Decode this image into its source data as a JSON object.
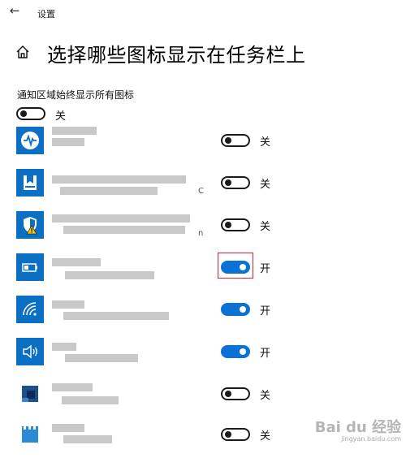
{
  "window": {
    "title": "设置",
    "back_icon": "back-arrow-icon"
  },
  "header": {
    "icon": "home-icon",
    "title": "选择哪些图标显示在任务栏上"
  },
  "master": {
    "label": "通知区域始终显示所有图标",
    "on": false,
    "state_text": "关"
  },
  "apps": [
    {
      "icon": "pulse-app-icon",
      "icon_color": "#0b6fc4",
      "on": false,
      "state_text": "关",
      "trail": ""
    },
    {
      "icon": "bookmark-app-icon",
      "icon_color": "#0b6fc4",
      "on": false,
      "state_text": "关",
      "trail": "C"
    },
    {
      "icon": "security-shield-warning-icon",
      "icon_color": "#0b6fc4",
      "on": false,
      "state_text": "关",
      "trail": "n"
    },
    {
      "icon": "battery-icon",
      "icon_color": "#0b6fc4",
      "on": true,
      "state_text": "开",
      "trail": ""
    },
    {
      "icon": "wifi-icon",
      "icon_color": "#0b6fc4",
      "on": true,
      "state_text": "开",
      "trail": ""
    },
    {
      "icon": "volume-icon",
      "icon_color": "#0b6fc4",
      "on": true,
      "state_text": "开",
      "trail": ""
    },
    {
      "icon": "app-icon-6",
      "icon_color": "#0b6fc4",
      "on": false,
      "state_text": "关",
      "trail": ""
    },
    {
      "icon": "app-icon-7",
      "icon_color": "#0b6fc4",
      "on": false,
      "state_text": "关",
      "trail": ""
    }
  ],
  "colors": {
    "accent": "#0a72d6",
    "highlight": "#d9232a",
    "icon_tile": "#0b6fc4"
  },
  "watermark": {
    "brand": "Bai du 经验",
    "url": "jingyan.baidu.com"
  }
}
